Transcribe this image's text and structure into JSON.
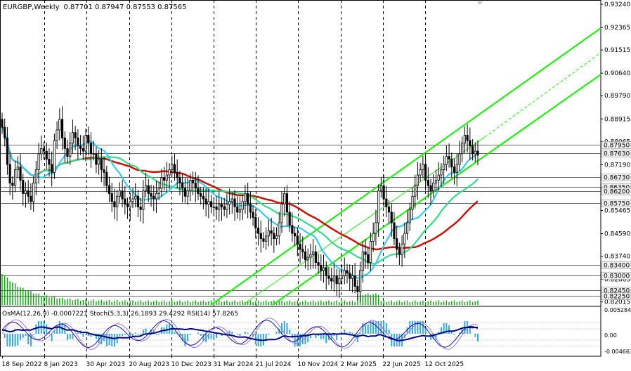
{
  "header": {
    "symbol_tf": "EURGBP,Weekly",
    "ohlc": "0.87701 0.87947 0.87553 0.87565"
  },
  "indicator_header": "OsMA(12,26,9) -0.0007221  Stoch(5,3,3) 26.1893 29.4292  RSI(14) 57.8265",
  "colors": {
    "ma_red": "#cc1100",
    "ma_green": "#33dd88",
    "ma_cyan": "#33ccee",
    "channel": "#22ee11",
    "candle": "#000000",
    "volume": "#00aa00",
    "osma": "#33aadd",
    "stoch_main": "#000099",
    "stoch_signal": "#9966cc",
    "rsi": "#000080",
    "level_line": "#333333",
    "price_box": "#eeeeee"
  },
  "chart_data": {
    "type": "candlestick",
    "title": "EURGBP,Weekly",
    "y_ticks": [
      "0.93240",
      "0.92365",
      "0.91515",
      "0.90640",
      "0.89790",
      "0.88915",
      "0.88065",
      "0.87190",
      "0.86340",
      "0.85465",
      "0.84590",
      "0.83740",
      "0.82865",
      "0.82015"
    ],
    "level_labels": [
      "0.87950",
      "0.87630",
      "0.86730",
      "0.86350",
      "0.86200",
      "0.85750",
      "0.83400",
      "0.83000",
      "0.82450",
      "0.82250"
    ],
    "level_values": [
      0.8795,
      0.8763,
      0.8673,
      0.8635,
      0.862,
      0.8575,
      0.834,
      0.83,
      0.8245,
      0.8225
    ],
    "ylim": [
      0.819,
      0.934
    ],
    "x_labels": [
      "18 Sep 2022",
      "8 Jan 2023",
      "30 Apr 2023",
      "20 Aug 2023",
      "10 Dec 2023",
      "31 Mar 2024",
      "21 Jul 2024",
      "10 Nov 2024",
      "2 Mar 2025",
      "22 Jun 2025",
      "12 Oct 2025"
    ],
    "closes": [
      0.886,
      0.882,
      0.872,
      0.865,
      0.864,
      0.87,
      0.871,
      0.866,
      0.861,
      0.862,
      0.86,
      0.858,
      0.865,
      0.87,
      0.876,
      0.878,
      0.877,
      0.874,
      0.872,
      0.869,
      0.881,
      0.885,
      0.889,
      0.882,
      0.878,
      0.875,
      0.88,
      0.884,
      0.882,
      0.879,
      0.878,
      0.877,
      0.883,
      0.88,
      0.876,
      0.876,
      0.872,
      0.874,
      0.87,
      0.869,
      0.864,
      0.861,
      0.858,
      0.856,
      0.86,
      0.862,
      0.859,
      0.857,
      0.856,
      0.858,
      0.859,
      0.86,
      0.856,
      0.855,
      0.862,
      0.864,
      0.861,
      0.86,
      0.859,
      0.861,
      0.863,
      0.867,
      0.866,
      0.868,
      0.87,
      0.872,
      0.869,
      0.867,
      0.865,
      0.863,
      0.86,
      0.862,
      0.866,
      0.865,
      0.863,
      0.861,
      0.86,
      0.859,
      0.857,
      0.858,
      0.856,
      0.856,
      0.855,
      0.857,
      0.856,
      0.855,
      0.857,
      0.858,
      0.859,
      0.856,
      0.854,
      0.855,
      0.858,
      0.861,
      0.857,
      0.854,
      0.852,
      0.848,
      0.846,
      0.844,
      0.843,
      0.845,
      0.847,
      0.846,
      0.844,
      0.845,
      0.85,
      0.857,
      0.861,
      0.854,
      0.849,
      0.846,
      0.845,
      0.842,
      0.84,
      0.839,
      0.836,
      0.837,
      0.838,
      0.839,
      0.835,
      0.834,
      0.832,
      0.833,
      0.83,
      0.829,
      0.828,
      0.83,
      0.827,
      0.829,
      0.83,
      0.832,
      0.831,
      0.829,
      0.83,
      0.826,
      0.824,
      0.832,
      0.839,
      0.838,
      0.835,
      0.843,
      0.846,
      0.85,
      0.862,
      0.864,
      0.859,
      0.856,
      0.854,
      0.85,
      0.844,
      0.84,
      0.838,
      0.842,
      0.846,
      0.85,
      0.855,
      0.86,
      0.864,
      0.868,
      0.87,
      0.872,
      0.866,
      0.864,
      0.862,
      0.865,
      0.866,
      0.868,
      0.87,
      0.872,
      0.875,
      0.874,
      0.871,
      0.869,
      0.872,
      0.876,
      0.88,
      0.883,
      0.881,
      0.879,
      0.876,
      0.877,
      0.8756
    ]
  },
  "icons": {
    "scroll_marker": "triangle-down-icon"
  }
}
